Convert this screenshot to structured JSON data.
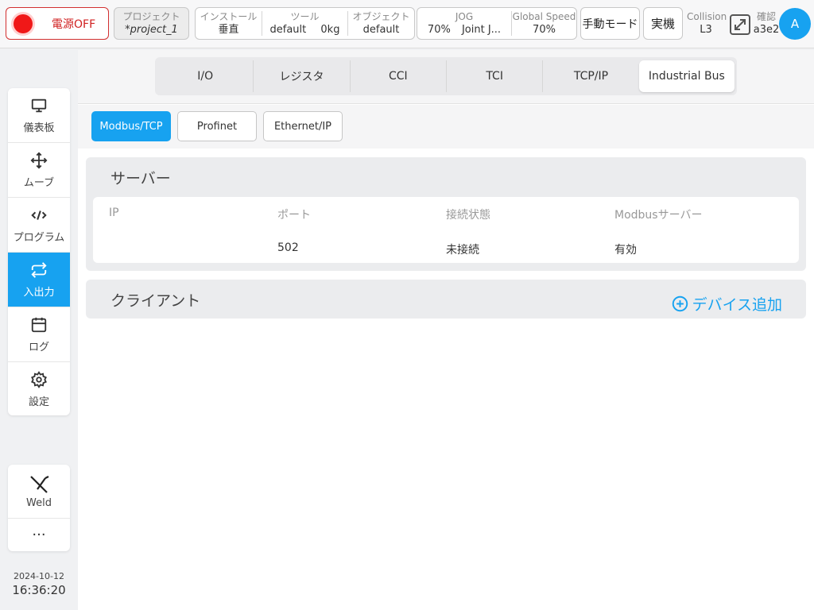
{
  "topbar": {
    "power_label": "電源OFF",
    "project": {
      "label": "プロジェクト",
      "value": "*project_1"
    },
    "install": {
      "label": "インストール",
      "value": "垂直"
    },
    "tool": {
      "label": "ツール",
      "value": "default",
      "weight": "0kg"
    },
    "object": {
      "label": "オブジェクト",
      "value": "default"
    },
    "jog": {
      "label": "JOG",
      "value": "70%",
      "mode": "Joint J..."
    },
    "speed": {
      "label": "Global Speed",
      "value": "70%"
    },
    "manual_mode": "手動モード",
    "real_machine": "実機",
    "collision": {
      "label": "Collision",
      "value": "L3"
    },
    "confirm": {
      "label": "確認",
      "value": "a3e2"
    },
    "avatar": "A"
  },
  "sidebar": {
    "items": [
      {
        "label": "儀表板",
        "icon": "monitor-icon"
      },
      {
        "label": "ムーブ",
        "icon": "move-icon"
      },
      {
        "label": "プログラム",
        "icon": "code-icon"
      },
      {
        "label": "入出力",
        "icon": "swap-icon"
      },
      {
        "label": "ログ",
        "icon": "calendar-icon"
      },
      {
        "label": "設定",
        "icon": "gear-icon"
      }
    ],
    "weld_label": "Weld",
    "more_label": "···",
    "date": "2024-10-12",
    "time": "16:36:20"
  },
  "tabs": [
    "I/O",
    "レジスタ",
    "CCI",
    "TCI",
    "TCP/IP",
    "Industrial Bus"
  ],
  "subtabs": [
    "Modbus/TCP",
    "Profinet",
    "Ethernet/IP"
  ],
  "server": {
    "title": "サーバー",
    "headers": [
      "IP",
      "ポート",
      "接続状態",
      "Modbusサーバー"
    ],
    "row": [
      "",
      "502",
      "未接続",
      "有効"
    ]
  },
  "client": {
    "title": "クライアント",
    "add_label": "デバイス追加"
  },
  "colors": {
    "accent": "#17a2f0",
    "power": "#f01818"
  }
}
